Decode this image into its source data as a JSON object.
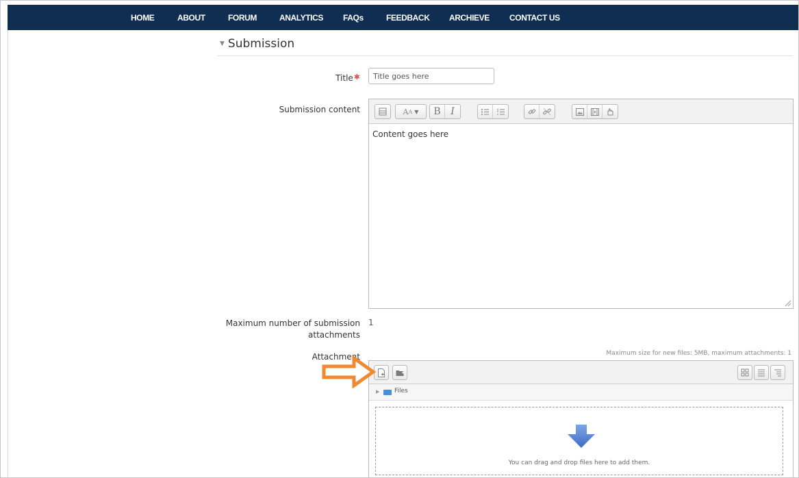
{
  "nav": {
    "items": [
      "HOME",
      "ABOUT",
      "FORUM",
      "ANALYTICS",
      "FAQs",
      "FEEDBACK",
      "ARCHIEVE",
      "CONTACT US"
    ]
  },
  "section": {
    "legend": "Submission"
  },
  "form": {
    "title_label": "Title",
    "title_value": "Title goes here",
    "content_label": "Submission content",
    "content_value": "Content goes here",
    "max_attach_label_line1": "Maximum number of submission",
    "max_attach_label_line2": "attachments",
    "max_attach_value": "1",
    "attachment_label": "Attachment"
  },
  "filepicker": {
    "max_note": "Maximum size for new files: 5MB, maximum attachments: 1",
    "path_root": "Files",
    "drop_hint": "You can drag and drop files here to add them."
  },
  "toolbar_icons": [
    "toolbar-toggle-icon",
    "font-style-icon",
    "bold-icon",
    "italic-icon",
    "unordered-list-icon",
    "ordered-list-icon",
    "link-icon",
    "unlink-icon",
    "image-icon",
    "media-icon",
    "manage-files-icon"
  ],
  "colors": {
    "navbar": "#102d52",
    "annotation_arrow": "#f0892f",
    "folder": "#4a8fd6",
    "required": "#d9534f"
  }
}
